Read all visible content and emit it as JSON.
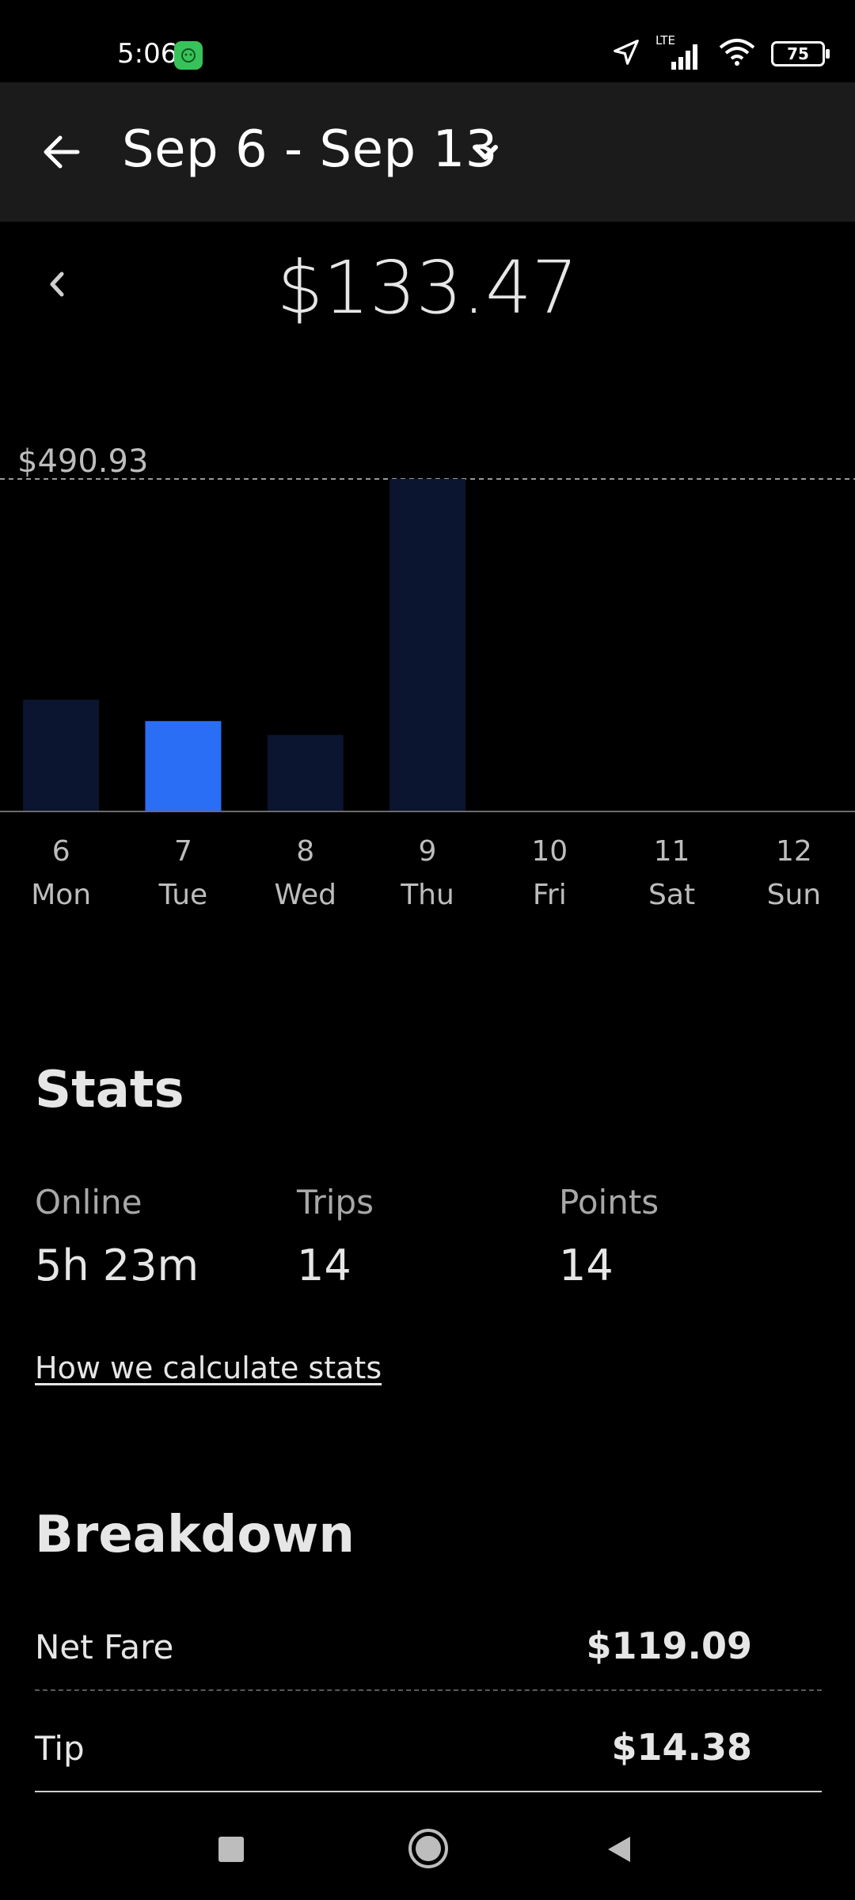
{
  "status_bar": {
    "time": "5:06",
    "network": "LTE",
    "battery": "75"
  },
  "header": {
    "date_range": "Sep 6 - Sep 13"
  },
  "summary": {
    "total": "$133.47"
  },
  "chart_data": {
    "type": "bar",
    "categories": [
      "6 Mon",
      "7 Tue",
      "8 Wed",
      "9 Thu",
      "10 Fri",
      "11 Sat",
      "12 Sun"
    ],
    "day_numbers": [
      "6",
      "7",
      "8",
      "9",
      "10",
      "11",
      "12"
    ],
    "day_names": [
      "Mon",
      "Tue",
      "Wed",
      "Thu",
      "Fri",
      "Sat",
      "Sun"
    ],
    "values": [
      165,
      133.47,
      113,
      490.93,
      0,
      0,
      0
    ],
    "selected_index": 1,
    "max_label": "$490.93",
    "ylim": [
      0,
      490.93
    ],
    "bar_color": "#0b1530",
    "selected_color": "#2a6ef5"
  },
  "stats": {
    "title": "Stats",
    "items": [
      {
        "label": "Online",
        "value": "5h 23m"
      },
      {
        "label": "Trips",
        "value": "14"
      },
      {
        "label": "Points",
        "value": "14"
      }
    ],
    "link": "How we calculate stats"
  },
  "breakdown": {
    "title": "Breakdown",
    "rows": [
      {
        "label": "Net Fare",
        "value": "$119.09"
      },
      {
        "label": "Tip",
        "value": "$14.38"
      }
    ]
  }
}
